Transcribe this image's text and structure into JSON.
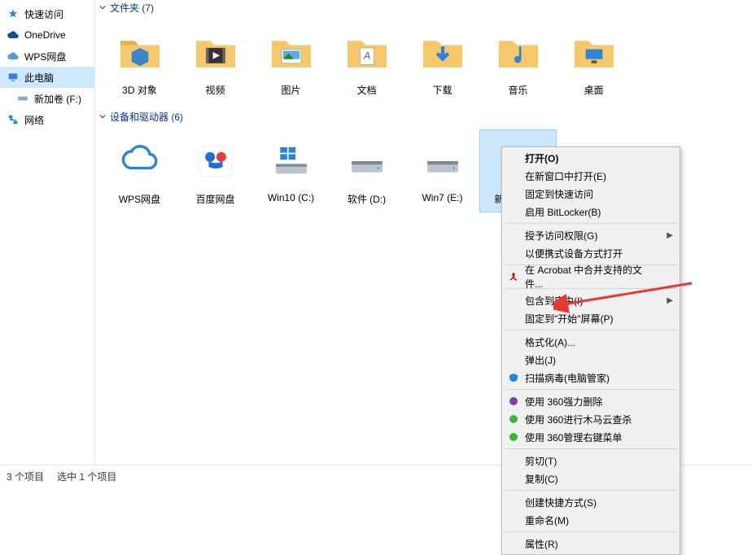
{
  "sidebar": {
    "items": [
      {
        "label": "快速访问",
        "icon": "star-icon"
      },
      {
        "label": "OneDrive",
        "icon": "cloud-icon"
      },
      {
        "label": "WPS网盘",
        "icon": "wps-cloud-icon"
      },
      {
        "label": "此电脑",
        "icon": "pc-icon",
        "selected": true
      },
      {
        "label": "新加卷 (F:)",
        "icon": "drive-icon"
      },
      {
        "label": "网络",
        "icon": "network-icon"
      }
    ]
  },
  "groups": {
    "folders": {
      "header": "文件夹 (7)",
      "items": [
        {
          "label": "3D 对象",
          "icon": "folder-3d"
        },
        {
          "label": "视频",
          "icon": "folder-video"
        },
        {
          "label": "图片",
          "icon": "folder-pictures"
        },
        {
          "label": "文档",
          "icon": "folder-docs"
        },
        {
          "label": "下载",
          "icon": "folder-download"
        },
        {
          "label": "音乐",
          "icon": "folder-music"
        },
        {
          "label": "桌面",
          "icon": "folder-desktop"
        }
      ]
    },
    "drives": {
      "header": "设备和驱动器 (6)",
      "items": [
        {
          "label": "WPS网盘",
          "icon": "wps-drive"
        },
        {
          "label": "百度网盘",
          "icon": "baidu-drive"
        },
        {
          "label": "Win10 (C:)",
          "icon": "windows-drive"
        },
        {
          "label": "软件 (D:)",
          "icon": "drive"
        },
        {
          "label": "Win7 (E:)",
          "icon": "drive"
        },
        {
          "label": "新加卷 (F:)",
          "icon": "drive",
          "selected": true
        }
      ]
    }
  },
  "statusbar": {
    "count": "3 个项目",
    "selection": "选中 1 个项目"
  },
  "context_menu": {
    "groups": [
      [
        {
          "label": "打开(O)",
          "bold": true
        },
        {
          "label": "在新窗口中打开(E)"
        },
        {
          "label": "固定到快速访问"
        },
        {
          "label": "启用 BitLocker(B)"
        }
      ],
      [
        {
          "label": "授予访问权限(G)",
          "submenu": true
        },
        {
          "label": "以便携式设备方式打开"
        }
      ],
      [
        {
          "label": "在 Acrobat 中合并支持的文件...",
          "icon": "acrobat-icon"
        }
      ],
      [
        {
          "label": "包含到库中(I)",
          "submenu": true
        },
        {
          "label": "固定到\"开始\"屏幕(P)"
        }
      ],
      [
        {
          "label": "格式化(A)..."
        },
        {
          "label": "弹出(J)"
        },
        {
          "label": "扫描病毒(电脑管家)",
          "icon": "shield-icon"
        }
      ],
      [
        {
          "label": "使用 360强力删除",
          "icon": "360-purple-icon"
        },
        {
          "label": "使用 360进行木马云查杀",
          "icon": "360-green-icon"
        },
        {
          "label": "使用 360管理右键菜单",
          "icon": "360-green-icon"
        }
      ],
      [
        {
          "label": "剪切(T)"
        },
        {
          "label": "复制(C)"
        }
      ],
      [
        {
          "label": "创建快捷方式(S)"
        },
        {
          "label": "重命名(M)"
        }
      ],
      [
        {
          "label": "属性(R)"
        }
      ]
    ]
  }
}
